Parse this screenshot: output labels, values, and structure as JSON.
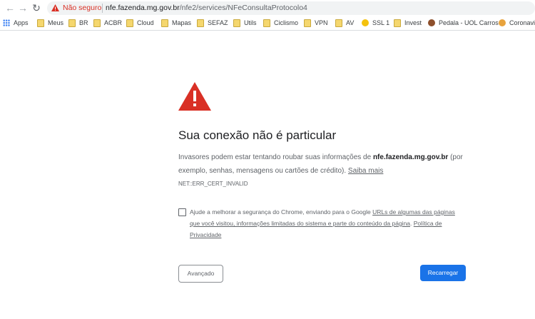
{
  "browser": {
    "security_label": "Não seguro",
    "url_host": "nfe.fazenda.mg.gov.br",
    "url_path": "/nfe2/services/NFeConsultaProtocolo4"
  },
  "bookmarks": [
    {
      "label": "Apps",
      "icon": "apps-grid-icon"
    },
    {
      "label": "Meus",
      "icon": "folder-icon"
    },
    {
      "label": "BR",
      "icon": "folder-icon"
    },
    {
      "label": "ACBR",
      "icon": "folder-icon"
    },
    {
      "label": "Cloud",
      "icon": "folder-icon"
    },
    {
      "label": "Mapas",
      "icon": "folder-icon"
    },
    {
      "label": "SEFAZ",
      "icon": "folder-icon"
    },
    {
      "label": "Utils",
      "icon": "folder-icon"
    },
    {
      "label": "Ciclismo",
      "icon": "folder-icon"
    },
    {
      "label": "VPN",
      "icon": "folder-icon"
    },
    {
      "label": "AV",
      "icon": "folder-icon"
    },
    {
      "label": "SSL 1",
      "icon": "ssl-icon"
    },
    {
      "label": "Invest",
      "icon": "folder-icon"
    },
    {
      "label": "Pedala - UOL Carros",
      "icon": "site-icon"
    },
    {
      "label": "Coronavin",
      "icon": "site-icon"
    }
  ],
  "interstitial": {
    "heading": "Sua conexão não é particular",
    "desc_part1": "Invasores podem estar tentando roubar suas informações de ",
    "desc_host": "nfe.fazenda.mg.gov.br",
    "desc_part2": " (por exemplo, senhas, mensagens ou cartões de crédito). ",
    "learn_more": "Saiba mais",
    "error_code": "NET::ERR_CERT_INVALID",
    "optin_text": "Ajude a melhorar a segurança do Chrome, enviando para o Google ",
    "optin_link1": "URLs de algumas das páginas que você visitou, informações limitadas do sistema e parte do conteúdo da página",
    "optin_dot": ". ",
    "optin_link2": "Política de Privacidade",
    "advanced_button": "Avançado",
    "reload_button": "Recarregar"
  },
  "colors": {
    "warning_red": "#d93025",
    "primary_blue": "#1a73e8"
  }
}
